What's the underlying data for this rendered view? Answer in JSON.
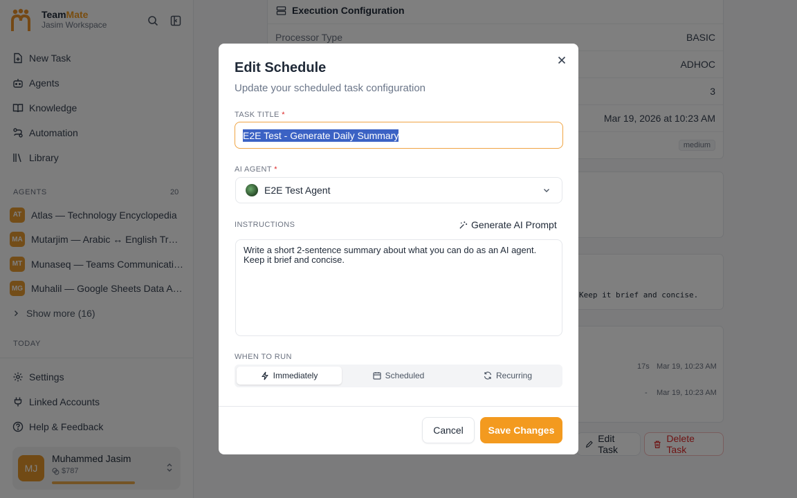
{
  "brand": {
    "name_part1": "Team",
    "name_part2": "Mate",
    "workspace": "Jasim Workspace"
  },
  "nav": [
    {
      "label": "New Task",
      "icon": "new-task-icon"
    },
    {
      "label": "Agents",
      "icon": "robot-icon"
    },
    {
      "label": "Knowledge",
      "icon": "book-icon"
    },
    {
      "label": "Automation",
      "icon": "route-icon"
    },
    {
      "label": "Library",
      "icon": "library-icon"
    }
  ],
  "agents_section": {
    "title": "AGENTS",
    "count": "20",
    "items": [
      {
        "initials": "AT",
        "name": "Atlas — Technology Encyclopedia"
      },
      {
        "initials": "MA",
        "name": "Mutarjim — Arabic ↔ English Transl..."
      },
      {
        "initials": "MT",
        "name": "Munaseq — Teams Communicatio..."
      },
      {
        "initials": "MG",
        "name": "Muhalil — Google Sheets Data Ana..."
      }
    ],
    "show_more": "Show more (16)"
  },
  "today_section": {
    "title": "TODAY"
  },
  "bottom_nav": [
    {
      "label": "Settings",
      "icon": "gear-icon"
    },
    {
      "label": "Linked Accounts",
      "icon": "plug-icon"
    },
    {
      "label": "Help & Feedback",
      "icon": "help-icon"
    }
  ],
  "user": {
    "initials": "MJ",
    "name": "Muhammed Jasim",
    "credit": "$787"
  },
  "background": {
    "exec_title": "Execution Configuration",
    "rows": [
      {
        "key": "Processor Type",
        "value": "BASIC"
      },
      {
        "value": "ADHOC"
      },
      {
        "value": "3"
      },
      {
        "value": "Mar 19, 2026 at 10:23 AM"
      },
      {
        "value": "medium"
      }
    ],
    "prompt_snippet": "Keep it brief and concise.",
    "runs": [
      {
        "duration": "17s",
        "time": "Mar 19, 10:23 AM"
      },
      {
        "duration": "-",
        "time": "Mar 19, 10:23 AM"
      }
    ],
    "edit_task": "Edit Task",
    "delete_task": "Delete Task"
  },
  "modal": {
    "title": "Edit Schedule",
    "description": "Update your scheduled task configuration",
    "task_title_label": "TASK TITLE",
    "task_title_value": "E2E Test - Generate Daily Summary",
    "agent_label": "AI AGENT",
    "agent_value": "E2E Test Agent",
    "instructions_label": "INSTRUCTIONS",
    "generate_label": "Generate AI Prompt",
    "instructions_line1": "Write a short 2-sentence summary about what you can do as an AI agent.",
    "instructions_line2": "Keep it brief and concise.",
    "when_label": "WHEN TO RUN",
    "when_options": [
      "Immediately",
      "Scheduled",
      "Recurring"
    ],
    "selected_option": "Immediately",
    "required_mark": "*",
    "cancel": "Cancel",
    "save": "Save Changes"
  },
  "colors": {
    "accent": "#f39a1f",
    "selection": "#3b62c4",
    "danger": "#dc2626"
  }
}
